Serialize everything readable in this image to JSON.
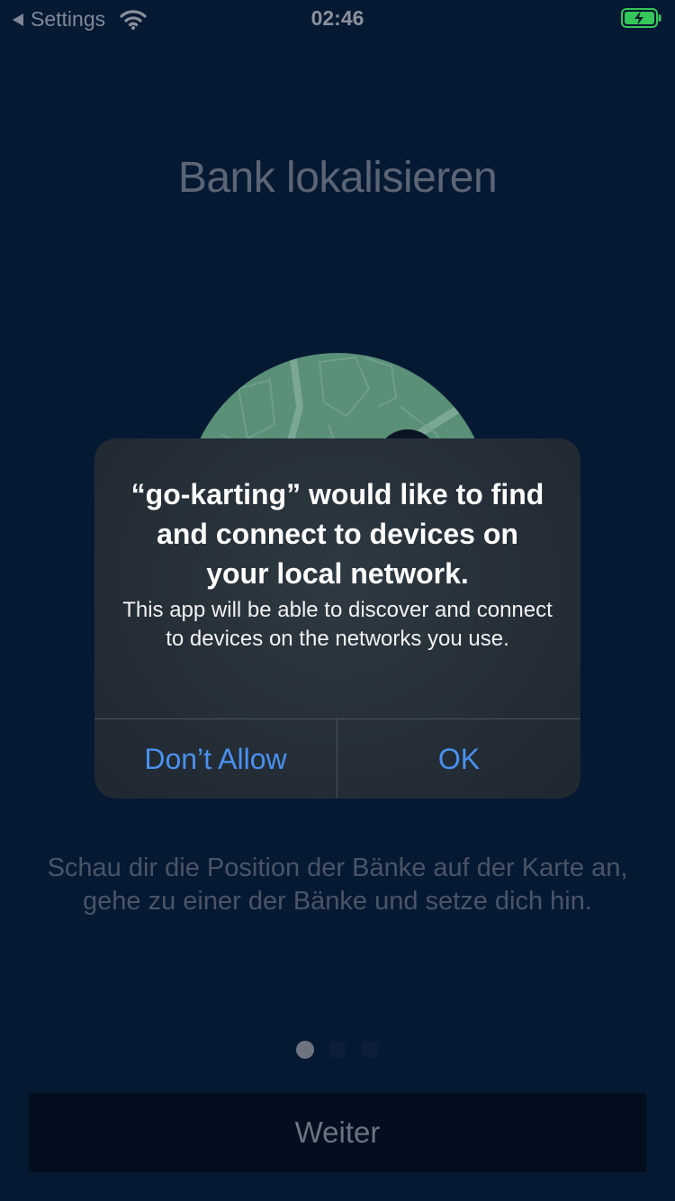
{
  "status_bar": {
    "back_label": "Settings",
    "time": "02:46",
    "battery_color": "#35c759"
  },
  "page": {
    "title": "Bank lokalisieren",
    "description": "Schau dir die Position der Bänke auf der Karte an, gehe zu einer der Bänke und setze dich hin.",
    "pager": {
      "count": 3,
      "active_index": 0
    },
    "next_button_label": "Weiter"
  },
  "alert": {
    "title": "“go-karting” would like to find and connect to devices on your local network.",
    "message": "This app will be able to discover and connect to devices on the networks you use.",
    "deny_label": "Don’t Allow",
    "ok_label": "OK",
    "button_color": "#4a90f0"
  },
  "colors": {
    "background": "#061933",
    "map_green": "#5a8f78"
  }
}
